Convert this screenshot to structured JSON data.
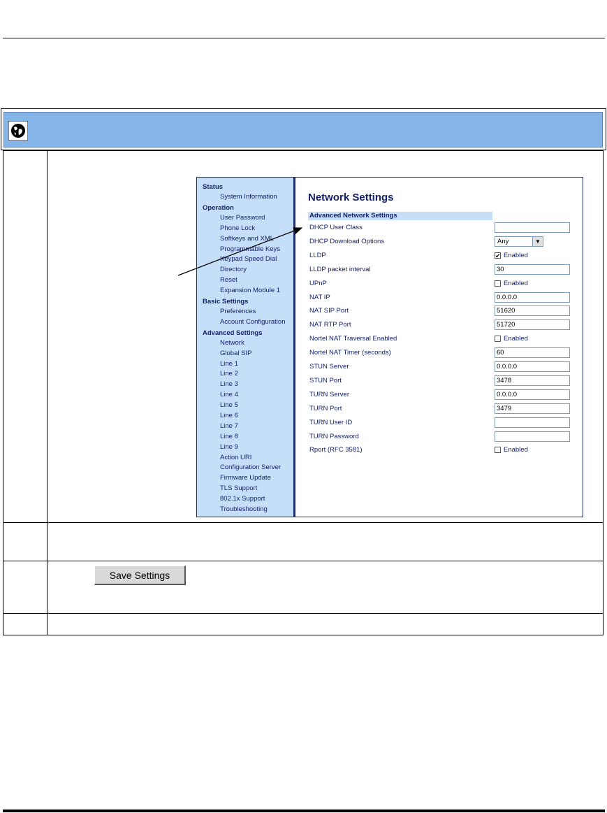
{
  "nav": {
    "sections": [
      {
        "header": "Status",
        "items": [
          "System Information"
        ]
      },
      {
        "header": "Operation",
        "items": [
          "User Password",
          "Phone Lock",
          "Softkeys and XML",
          "Programmable Keys",
          "Keypad Speed Dial",
          "Directory",
          "Reset",
          "Expansion Module 1"
        ]
      },
      {
        "header": "Basic Settings",
        "items": [
          "Preferences",
          "Account Configuration"
        ]
      },
      {
        "header": "Advanced Settings",
        "items": [
          "Network",
          "Global SIP",
          "Line 1",
          "Line 2",
          "Line 3",
          "Line 4",
          "Line 5",
          "Line 6",
          "Line 7",
          "Line 8",
          "Line 9",
          "Action URI",
          "Configuration Server",
          "Firmware Update",
          "TLS Support",
          "802.1x Support",
          "Troubleshooting"
        ]
      }
    ]
  },
  "content": {
    "title": "Network Settings",
    "section": "Advanced Network Settings",
    "rows": [
      {
        "label": "DHCP User Class",
        "type": "text",
        "value": ""
      },
      {
        "label": "DHCP Download Options",
        "type": "select",
        "value": "Any"
      },
      {
        "label": "LLDP",
        "type": "checkbox",
        "checked": true,
        "check_label": "Enabled"
      },
      {
        "label": "LLDP packet interval",
        "type": "text",
        "value": "30"
      },
      {
        "label": "UPnP",
        "type": "checkbox",
        "checked": false,
        "check_label": "Enabled"
      },
      {
        "label": "NAT IP",
        "type": "text",
        "value": "0.0.0.0"
      },
      {
        "label": "NAT SIP Port",
        "type": "text",
        "value": "51620"
      },
      {
        "label": "NAT RTP Port",
        "type": "text",
        "value": "51720"
      },
      {
        "label": "Nortel NAT Traversal Enabled",
        "type": "checkbox",
        "checked": false,
        "check_label": "Enabled"
      },
      {
        "label": "Nortel NAT Timer (seconds)",
        "type": "text",
        "value": "60"
      },
      {
        "label": "STUN Server",
        "type": "text",
        "value": "0.0.0.0"
      },
      {
        "label": "STUN Port",
        "type": "text",
        "value": "3478"
      },
      {
        "label": "TURN Server",
        "type": "text",
        "value": "0.0.0.0"
      },
      {
        "label": "TURN Port",
        "type": "text",
        "value": "3479"
      },
      {
        "label": "TURN User ID",
        "type": "text",
        "value": ""
      },
      {
        "label": "TURN Password",
        "type": "text",
        "value": ""
      },
      {
        "label": "Rport (RFC 3581)",
        "type": "checkbox",
        "checked": false,
        "check_label": "Enabled"
      }
    ]
  },
  "save_button": {
    "label": "Save Settings"
  },
  "icons": {
    "banner": "globe-icon"
  },
  "colors": {
    "banner": "#84b4e8",
    "nav_bg": "#c6dff8",
    "nav_text": "#14206a"
  }
}
